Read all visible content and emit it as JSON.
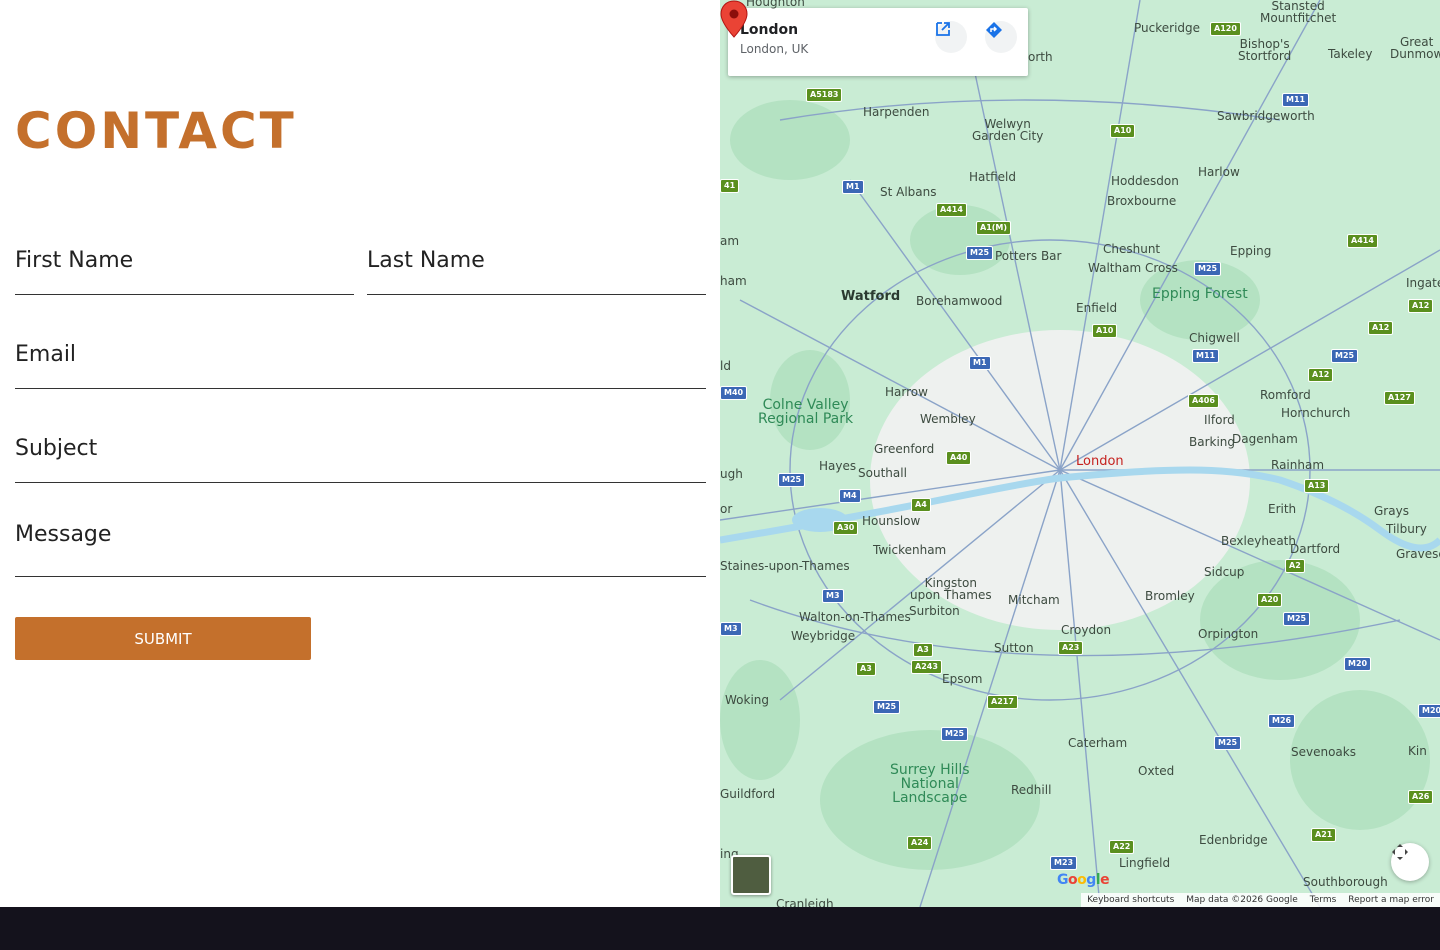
{
  "form": {
    "title": "CONTACT",
    "first_name_placeholder": "First Name",
    "last_name_placeholder": "Last Name",
    "email_placeholder": "Email",
    "subject_placeholder": "Subject",
    "message_placeholder": "Message",
    "submit_label": "SUBMIT",
    "accent_color": "#c4702c"
  },
  "map": {
    "card": {
      "name": "London",
      "address": "London, UK"
    },
    "pin_label": "London",
    "places": [
      {
        "text": "Houghton"
      },
      {
        "text": "Stansted\nMountfitchet"
      },
      {
        "text": "Puckeridge"
      },
      {
        "text": "Bishop's\nStortford"
      },
      {
        "text": "Takeley"
      },
      {
        "text": "Great\nDunmow"
      },
      {
        "text": "Sawbridgeworth"
      },
      {
        "text": "Harpenden"
      },
      {
        "text": "Welwyn\nGarden City"
      },
      {
        "text": "Hatfield"
      },
      {
        "text": "St Albans"
      },
      {
        "text": "Hoddesdon"
      },
      {
        "text": "Harlow"
      },
      {
        "text": "Broxbourne"
      },
      {
        "text": "Cheshunt"
      },
      {
        "text": "Waltham Cross"
      },
      {
        "text": "Epping"
      },
      {
        "text": "Potters Bar"
      },
      {
        "text": "Watford"
      },
      {
        "text": "Borehamwood"
      },
      {
        "text": "Enfield"
      },
      {
        "text": "Chigwell"
      },
      {
        "text": "Harrow"
      },
      {
        "text": "Wembley"
      },
      {
        "text": "Romford"
      },
      {
        "text": "Hornchurch"
      },
      {
        "text": "Ilford"
      },
      {
        "text": "Barking"
      },
      {
        "text": "Dagenham"
      },
      {
        "text": "Greenford"
      },
      {
        "text": "Hayes"
      },
      {
        "text": "Southall"
      },
      {
        "text": "Rainham"
      },
      {
        "text": "Hounslow"
      },
      {
        "text": "Erith"
      },
      {
        "text": "Grays"
      },
      {
        "text": "Tilbury"
      },
      {
        "text": "Twickenham"
      },
      {
        "text": "Bexleyheath"
      },
      {
        "text": "Dartford"
      },
      {
        "text": "Staines-upon-Thames"
      },
      {
        "text": "Sidcup"
      },
      {
        "text": "Kingston\nupon Thames"
      },
      {
        "text": "Bromley"
      },
      {
        "text": "Walton-on-Thames"
      },
      {
        "text": "Surbiton"
      },
      {
        "text": "Mitcham"
      },
      {
        "text": "Weybridge"
      },
      {
        "text": "Croydon"
      },
      {
        "text": "Orpington"
      },
      {
        "text": "Sutton"
      },
      {
        "text": "Epsom"
      },
      {
        "text": "Woking"
      },
      {
        "text": "Caterham"
      },
      {
        "text": "Sevenoaks"
      },
      {
        "text": "Oxted"
      },
      {
        "text": "Redhill"
      },
      {
        "text": "Guildford"
      },
      {
        "text": "Edenbridge"
      },
      {
        "text": "Lingfield"
      },
      {
        "text": "Southborough"
      },
      {
        "text": "Cranleigh"
      },
      {
        "text": "Gravese"
      },
      {
        "text": "Ingate"
      },
      {
        "text": "Kin"
      },
      {
        "text": "orth"
      },
      {
        "text": "am"
      },
      {
        "text": "ham"
      },
      {
        "text": "ld"
      },
      {
        "text": "ugh"
      },
      {
        "text": "or"
      },
      {
        "text": "ing"
      },
      {
        "text": "Epping Forest"
      },
      {
        "text": "Colne Valley\nRegional Park"
      },
      {
        "text": "Surrey Hills\nNational\nLandscape"
      }
    ],
    "shields": [
      "A120",
      "A5183",
      "M11",
      "A10",
      "M1",
      "A414",
      "A1(M)",
      "M25",
      "M25",
      "A414",
      "A12",
      "A12",
      "A10",
      "M11",
      "M25",
      "M1",
      "A12",
      "M40",
      "A406",
      "A127",
      "M25",
      "A40",
      "A13",
      "M4",
      "A4",
      "A30",
      "A2",
      "A20",
      "M3",
      "M25",
      "M20",
      "A3",
      "A23",
      "A3",
      "A243",
      "M25",
      "A217",
      "M26",
      "M20",
      "M25",
      "M25",
      "A26",
      "A22",
      "A24",
      "M23",
      "A21",
      "M3",
      "41"
    ],
    "logo": "Google",
    "attribution": [
      "Keyboard shortcuts",
      "Map data ©2026 Google",
      "Terms",
      "Report a map error"
    ]
  }
}
